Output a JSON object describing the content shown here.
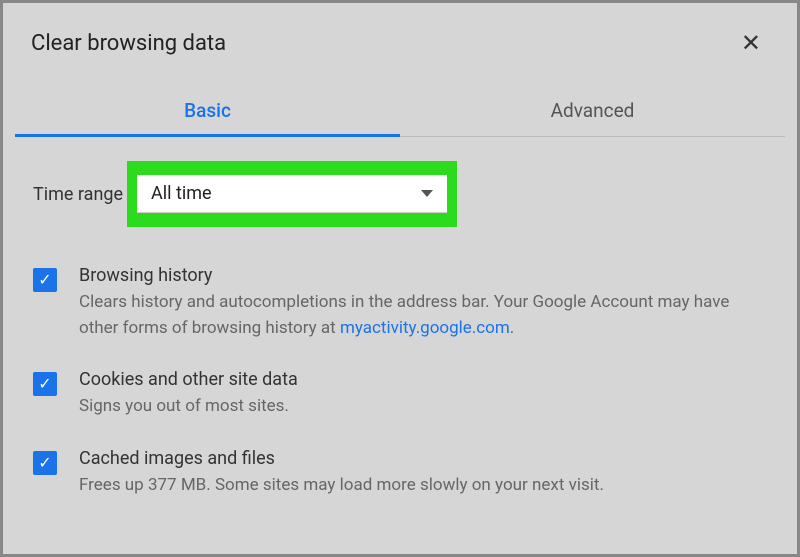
{
  "dialog": {
    "title": "Clear browsing data"
  },
  "tabs": {
    "basic": "Basic",
    "advanced": "Advanced"
  },
  "time_range": {
    "label": "Time range",
    "value": "All time"
  },
  "options": {
    "browsing_history": {
      "title": "Browsing history",
      "desc_before": "Clears history and autocompletions in the address bar. Your Google Account may have other forms of browsing history at ",
      "link": "myactivity.google.com",
      "desc_after": "."
    },
    "cookies": {
      "title": "Cookies and other site data",
      "desc": "Signs you out of most sites."
    },
    "cache": {
      "title": "Cached images and files",
      "desc": "Frees up 377 MB. Some sites may load more slowly on your next visit."
    }
  }
}
